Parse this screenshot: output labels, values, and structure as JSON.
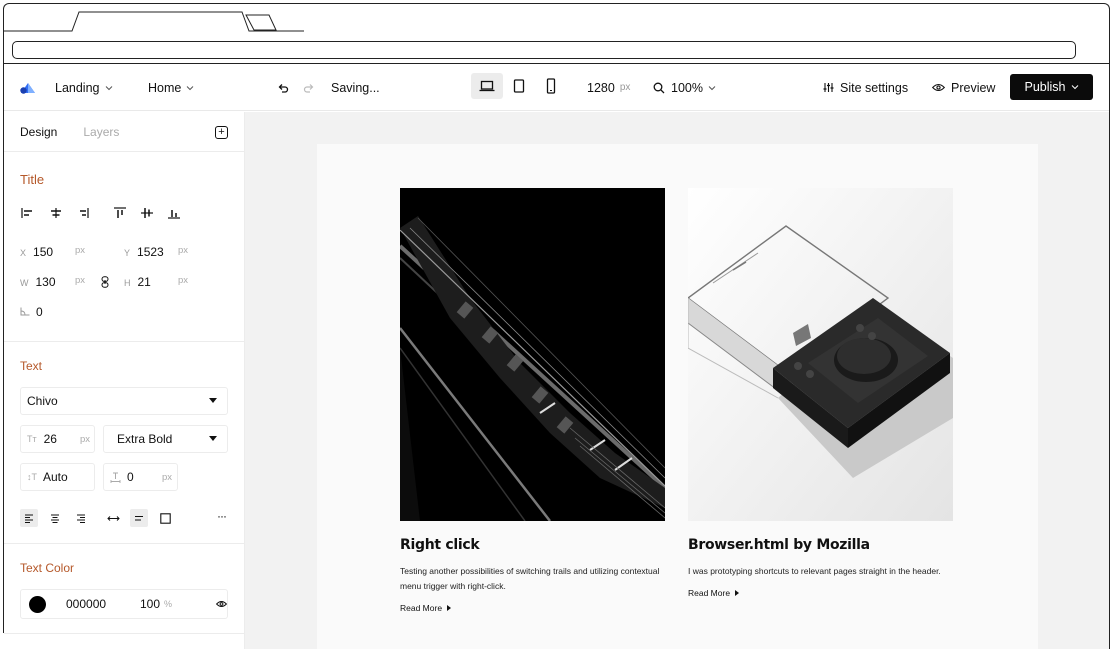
{
  "topbar": {
    "project": "Landing",
    "page": "Home",
    "status": "Saving...",
    "width_value": "1280",
    "width_unit": "px",
    "zoom": "100%",
    "site_settings": "Site settings",
    "preview": "Preview",
    "publish": "Publish"
  },
  "sidebar": {
    "tabs": {
      "design": "Design",
      "layers": "Layers"
    },
    "title_section": {
      "heading": "Title",
      "x_label": "X",
      "x": "150",
      "x_unit": "px",
      "y_label": "Y",
      "y": "1523",
      "y_unit": "px",
      "w_label": "W",
      "w": "130",
      "w_unit": "px",
      "h_label": "H",
      "h": "21",
      "h_unit": "px",
      "rotation": "0"
    },
    "text_section": {
      "heading": "Text",
      "font": "Chivo",
      "size": "26",
      "size_unit": "px",
      "weight": "Extra Bold",
      "line_height": "Auto",
      "letter_spacing": "0",
      "letter_spacing_unit": "px",
      "more": "···"
    },
    "color_section": {
      "heading": "Text Color",
      "hex": "000000",
      "opacity": "100",
      "opacity_unit": "%",
      "swatch": "#000000"
    }
  },
  "cards": [
    {
      "title": "Right click",
      "description": "Testing another possibilities of switching trails and utilizing contextual menu trigger with right-click.",
      "link": "Read More"
    },
    {
      "title": "Browser.html by Mozilla",
      "description": "I was prototyping shortcuts to relevant pages straight in the header.",
      "link": "Read More"
    }
  ],
  "colors": {
    "accent": "#b5582a",
    "logo": "#2f6df6",
    "publish_bg": "#0b0b0b"
  }
}
